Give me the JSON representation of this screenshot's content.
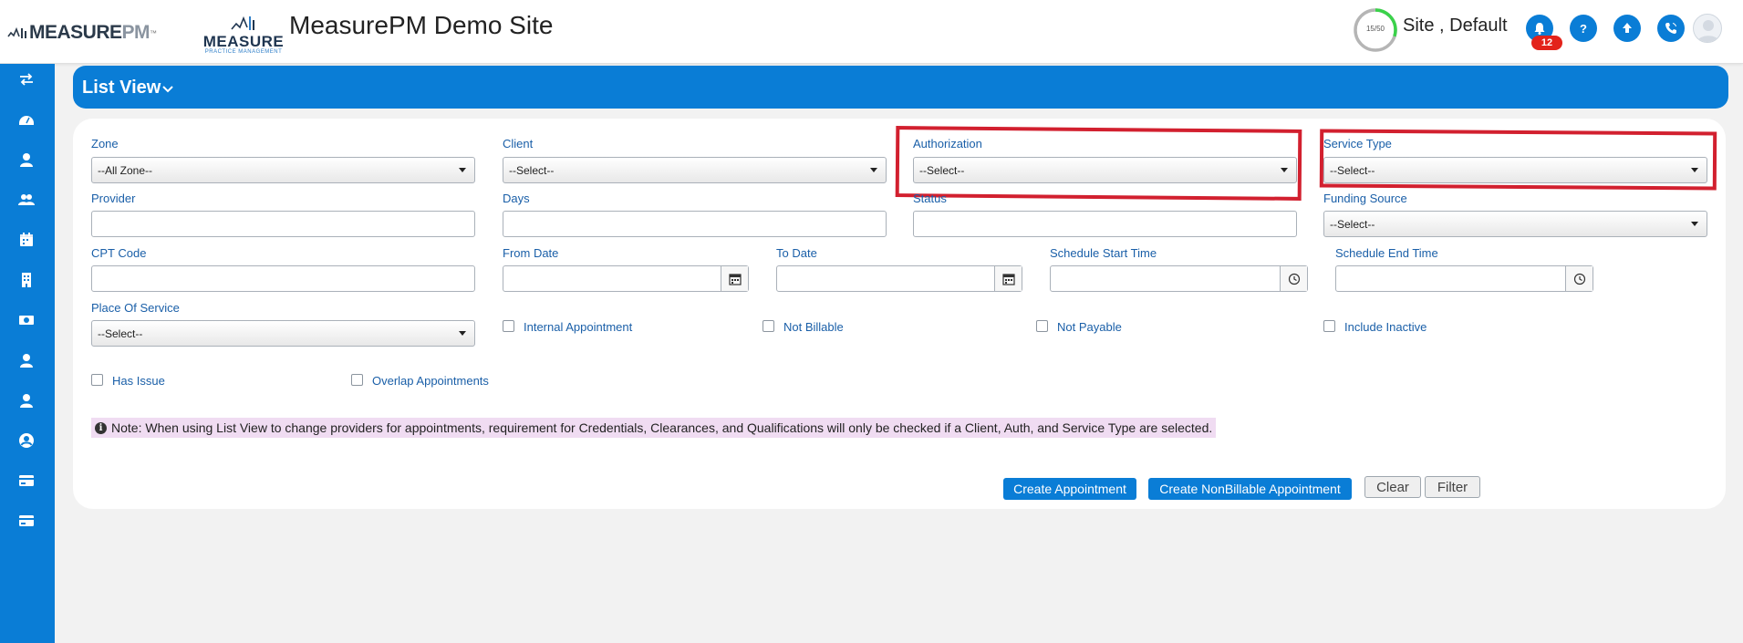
{
  "header": {
    "logo_brand": "MEASURE",
    "logo_brand_pm": "PM",
    "logo_tm": "™",
    "logo2_word": "MEASURE",
    "logo2_sub": "PRACTICE MANAGEMENT",
    "site_title": "MeasurePM Demo Site",
    "progress_label": "15/50",
    "progress_fraction": 0.3,
    "user_label": "Site , Default",
    "notification_count": "12",
    "accent_color": "#0a7dd6",
    "icons": [
      "bell-icon",
      "help-icon",
      "upload-icon",
      "phone-icon",
      "avatar"
    ]
  },
  "sidebar": {
    "items": [
      "swap-icon",
      "dashboard-icon",
      "user-icon",
      "users-icon",
      "calendar-icon",
      "building-icon",
      "money-icon",
      "person-icon",
      "person-alt-icon",
      "account-circle-icon",
      "credit-card-icon",
      "card-icon"
    ]
  },
  "listview": {
    "title": "List View"
  },
  "filters": {
    "zone_label": "Zone",
    "zone_value": "--All Zone--",
    "client_label": "Client",
    "client_value": "--Select--",
    "authorization_label": "Authorization",
    "authorization_value": "--Select--",
    "service_type_label": "Service Type",
    "service_type_value": "--Select--",
    "provider_label": "Provider",
    "days_label": "Days",
    "status_label": "Status",
    "funding_source_label": "Funding Source",
    "funding_source_value": "--Select--",
    "cpt_code_label": "CPT Code",
    "from_date_label": "From Date",
    "to_date_label": "To Date",
    "schedule_start_label": "Schedule Start Time",
    "schedule_end_label": "Schedule End Time",
    "place_of_service_label": "Place Of Service",
    "place_of_service_value": "--Select--",
    "internal_appointment_label": "Internal Appointment",
    "not_billable_label": "Not Billable",
    "not_payable_label": "Not Payable",
    "include_inactive_label": "Include Inactive",
    "has_issue_label": "Has Issue",
    "overlap_label": "Overlap Appointments"
  },
  "note": {
    "text": "Note: When using List View to change providers for appointments, requirement for Credentials, Clearances, and Qualifications will only be checked if a Client, Auth, and Service Type are selected."
  },
  "actions": {
    "create_label": "Create Appointment",
    "create_nonbillable_label": "Create NonBillable Appointment",
    "clear_label": "Clear",
    "filter_label": "Filter"
  }
}
